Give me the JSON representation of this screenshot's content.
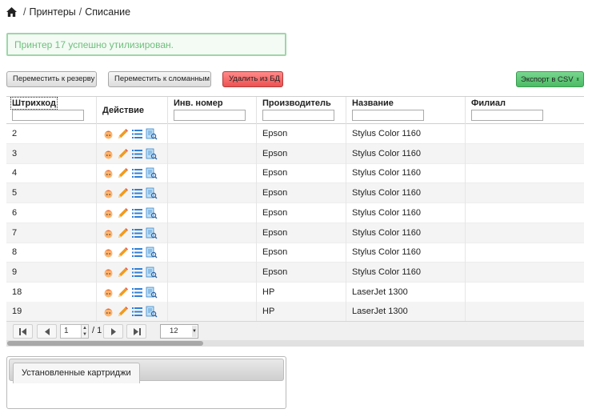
{
  "breadcrumb": {
    "home_icon": "home-icon",
    "items": [
      "Принтеры",
      "Списание"
    ],
    "separator": "/"
  },
  "alert": {
    "text": "Принтер 17 успешно утилизирован.",
    "color": "#6fbf7d"
  },
  "toolbar": {
    "move_reserve": "Переместить к резерву",
    "move_broken": "Переместить к сломанным",
    "delete_db": "Удалить из БД",
    "export_csv": "Экспорт в CSV"
  },
  "grid": {
    "columns": [
      "Штрихкод",
      "Действие",
      "Инв. номер",
      "Производитель",
      "Название",
      "Филиал"
    ],
    "rows": [
      {
        "barcode": "2",
        "inv": "",
        "vendor": "Epson",
        "name": "Stylus Color 1160",
        "branch": ""
      },
      {
        "barcode": "3",
        "inv": "",
        "vendor": "Epson",
        "name": "Stylus Color 1160",
        "branch": ""
      },
      {
        "barcode": "4",
        "inv": "",
        "vendor": "Epson",
        "name": "Stylus Color 1160",
        "branch": ""
      },
      {
        "barcode": "5",
        "inv": "",
        "vendor": "Epson",
        "name": "Stylus Color 1160",
        "branch": ""
      },
      {
        "barcode": "6",
        "inv": "",
        "vendor": "Epson",
        "name": "Stylus Color 1160",
        "branch": ""
      },
      {
        "barcode": "7",
        "inv": "",
        "vendor": "Epson",
        "name": "Stylus Color 1160",
        "branch": ""
      },
      {
        "barcode": "8",
        "inv": "",
        "vendor": "Epson",
        "name": "Stylus Color 1160",
        "branch": ""
      },
      {
        "barcode": "9",
        "inv": "",
        "vendor": "Epson",
        "name": "Stylus Color 1160",
        "branch": ""
      },
      {
        "barcode": "18",
        "inv": "",
        "vendor": "HP",
        "name": "LaserJet 1300",
        "branch": ""
      },
      {
        "barcode": "19",
        "inv": "",
        "vendor": "HP",
        "name": "LaserJet 1300",
        "branch": ""
      }
    ],
    "action_icons": [
      "person-icon",
      "edit-pencil-icon",
      "list-icon",
      "search-document-icon"
    ]
  },
  "pager": {
    "page": "1",
    "of_text": "/ 1",
    "page_size": "12"
  },
  "tabs": {
    "items": [
      "Установленные картриджи"
    ]
  },
  "colors": {
    "danger": "#ee5151",
    "export": "#4cbb66",
    "alert_border": "#9fd6a8"
  }
}
